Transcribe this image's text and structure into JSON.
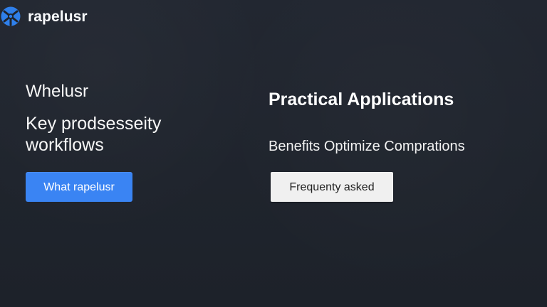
{
  "brand": {
    "name": "rapelusr",
    "icon": "network-logo-icon",
    "accent_color": "#3a84f3"
  },
  "left": {
    "eyebrow": "Whelusr",
    "headline": "Key prodsesseity workflows",
    "primary_button": "What rapelusr"
  },
  "right": {
    "title": "Practical Applications",
    "subtitle": "Benefits Optimize Comprations",
    "secondary_button": "Frequenty asked"
  },
  "colors": {
    "background": "#1f232b",
    "primary_button": "#3a84f3",
    "secondary_button": "#f0f0f0",
    "text": "#f3f4f6"
  }
}
